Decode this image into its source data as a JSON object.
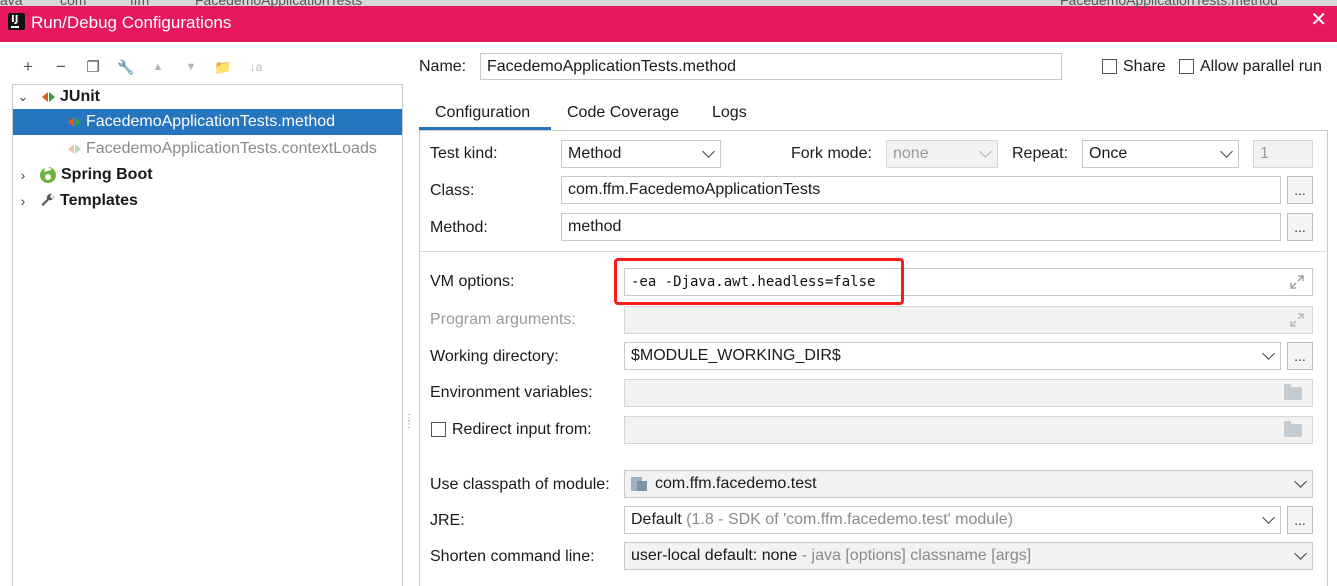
{
  "background_tabs": [
    "ava",
    "com",
    "ffm",
    "FacedemoApplicationTests",
    "FacedemoApplicationTests.method"
  ],
  "window": {
    "title": "Run/Debug Configurations",
    "close_glyph": "✕",
    "accent": "#e8185d",
    "selection": "#2675bf",
    "highlight": "#ff1a1a"
  },
  "toolbar": {
    "add": "+",
    "remove": "−",
    "copy": "❐",
    "edit": "🔧",
    "up": "▲",
    "down": "▼",
    "folder": "📁",
    "sort": "↓a"
  },
  "tree": {
    "junit": "JUnit",
    "item_method": "FacedemoApplicationTests.method",
    "item_context": "FacedemoApplicationTests.contextLoads",
    "spring_boot": "Spring Boot",
    "templates": "Templates"
  },
  "header": {
    "name_label": "Name:",
    "name_value": "FacedemoApplicationTests.method",
    "share_label": "Share",
    "parallel_label": "Allow parallel run"
  },
  "tabs": [
    "Configuration",
    "Code Coverage",
    "Logs"
  ],
  "form": {
    "test_kind_label": "Test kind:",
    "test_kind_value": "Method",
    "fork_mode_label": "Fork mode:",
    "fork_mode_value": "none",
    "repeat_label": "Repeat:",
    "repeat_value": "Once",
    "repeat_count": "1",
    "class_label": "Class:",
    "class_value": "com.ffm.FacedemoApplicationTests",
    "method_label": "Method:",
    "method_value": "method",
    "vm_label": "VM options:",
    "vm_value": "-ea -Djava.awt.headless=false",
    "program_args_label": "Program arguments:",
    "working_dir_label": "Working directory:",
    "working_dir_value": "$MODULE_WORKING_DIR$",
    "env_label": "Environment variables:",
    "redirect_label": "Redirect input from:",
    "classpath_label": "Use classpath of module:",
    "classpath_value": "com.ffm.facedemo.test",
    "jre_label": "JRE:",
    "jre_value": "Default",
    "jre_hint": "(1.8 - SDK of 'com.ffm.facedemo.test' module)",
    "shorten_label": "Shorten command line:",
    "shorten_value": "user-local default: none",
    "shorten_hint": "- java [options] classname [args]",
    "browse": "..."
  }
}
